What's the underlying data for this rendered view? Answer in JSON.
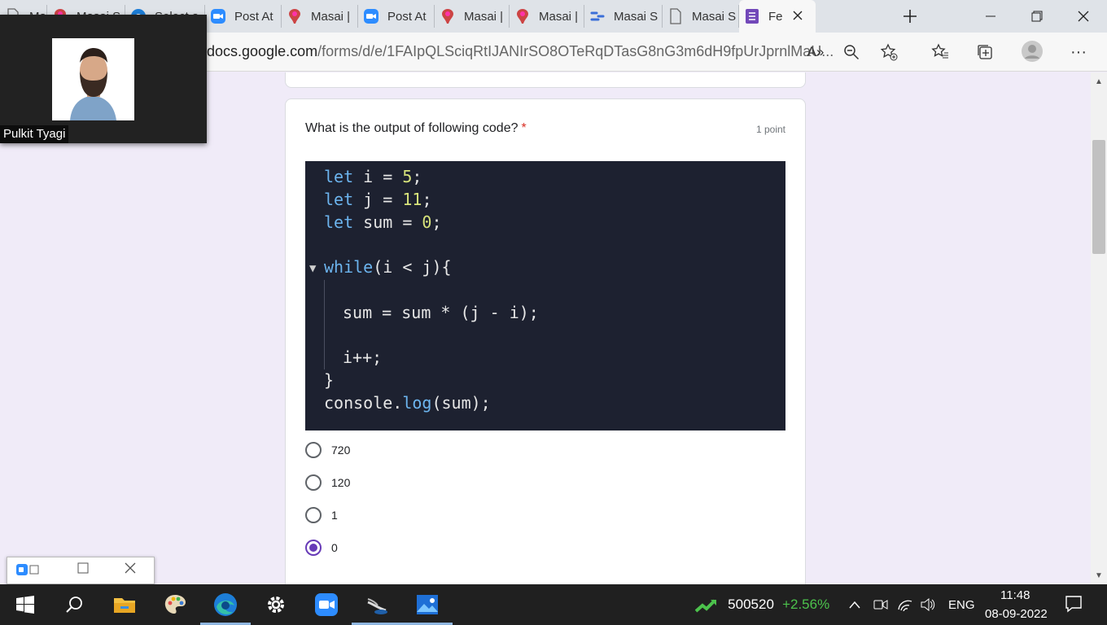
{
  "browser": {
    "tabs": [
      {
        "label": "Masai S",
        "icon": "document-icon"
      },
      {
        "label": "Masai S",
        "icon": "masai-icon"
      },
      {
        "label": "Select a",
        "icon": "edge-icon"
      },
      {
        "label": "Post At",
        "icon": "zoom-icon"
      },
      {
        "label": "Masai |",
        "icon": "masai-icon"
      },
      {
        "label": "Post At",
        "icon": "zoom-icon"
      },
      {
        "label": "Masai |",
        "icon": "masai-icon"
      },
      {
        "label": "Masai |",
        "icon": "masai-icon"
      },
      {
        "label": "Masai S",
        "icon": "pipeline-icon"
      },
      {
        "label": "Masai S",
        "icon": "document-icon"
      },
      {
        "label": "Fe",
        "icon": "forms-icon",
        "active": true
      }
    ],
    "url_domain": "docs.google.com",
    "url_path": "/forms/d/e/1FAIpQLSciqRtIJANIrSO8OTeRqDTasG8nG3m6dH9fpUrJprnlMaU..."
  },
  "video": {
    "participant_name": "Pulkit Tyagi"
  },
  "question": {
    "text": "What is the output of following code?",
    "required_mark": "*",
    "points": "1 point",
    "code_lines": [
      {
        "indent": 0,
        "tokens": [
          [
            "kw",
            "let"
          ],
          [
            "p",
            " i = "
          ],
          [
            "num",
            "5"
          ],
          [
            "p",
            ";"
          ]
        ]
      },
      {
        "indent": 0,
        "tokens": [
          [
            "kw",
            "let"
          ],
          [
            "p",
            " j = "
          ],
          [
            "num",
            "11"
          ],
          [
            "p",
            ";"
          ]
        ]
      },
      {
        "indent": 0,
        "tokens": [
          [
            "kw",
            "let"
          ],
          [
            "p",
            " sum = "
          ],
          [
            "num",
            "0"
          ],
          [
            "p",
            ";"
          ]
        ]
      },
      {
        "indent": 0,
        "tokens": []
      },
      {
        "indent": 0,
        "tokens": [
          [
            "kw",
            "while"
          ],
          [
            "p",
            "(i < j){"
          ]
        ]
      },
      {
        "indent": 0,
        "tokens": []
      },
      {
        "indent": 1,
        "tokens": [
          [
            "p",
            "sum = sum * (j - i);"
          ]
        ]
      },
      {
        "indent": 0,
        "tokens": []
      },
      {
        "indent": 1,
        "tokens": [
          [
            "p",
            "i++;"
          ]
        ]
      },
      {
        "indent": 0,
        "tokens": [
          [
            "p",
            "}"
          ]
        ]
      },
      {
        "indent": 0,
        "tokens": [
          [
            "p",
            "console."
          ],
          [
            "fn",
            "log"
          ],
          [
            "p",
            "(sum);"
          ]
        ]
      }
    ],
    "options": [
      {
        "label": "720",
        "selected": false
      },
      {
        "label": "120",
        "selected": false
      },
      {
        "label": "1",
        "selected": false
      },
      {
        "label": "0",
        "selected": true
      }
    ]
  },
  "taskbar": {
    "stock_value": "500520",
    "stock_change": "+2.56%",
    "language": "ENG",
    "time": "11:48",
    "date": "08-09-2022"
  },
  "colors": {
    "accent": "#673ab7",
    "required": "#d93025",
    "stock_up": "#4cc24c",
    "code_bg": "#1d2130"
  }
}
